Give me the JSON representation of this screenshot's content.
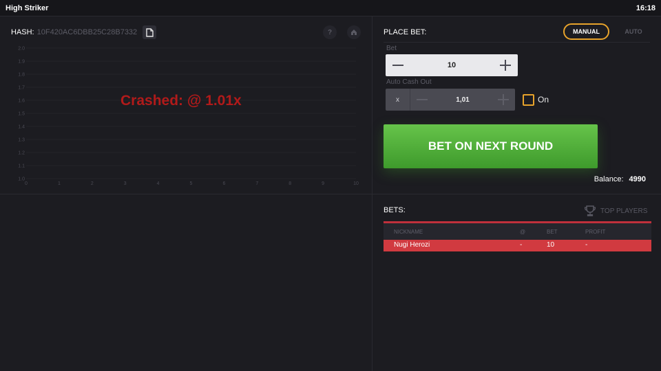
{
  "window": {
    "title": "High Striker",
    "time": "16:18"
  },
  "graph": {
    "hash_label": "HASH:",
    "hash_value": "10F420AC6DBB25C28B7332",
    "status": "Crashed: @ 1.01x"
  },
  "chart_data": {
    "type": "line",
    "x_ticks": [
      "0",
      "1",
      "2",
      "3",
      "4",
      "5",
      "6",
      "7",
      "8",
      "9",
      "10"
    ],
    "y_ticks": [
      "2.0",
      "1.9",
      "1.8",
      "1.7",
      "1.6",
      "1.5",
      "1.4",
      "1.3",
      "1.2",
      "1.1",
      "1.0"
    ],
    "xlim": [
      0,
      10
    ],
    "ylim": [
      1.0,
      2.0
    ],
    "series": []
  },
  "place_bet": {
    "title": "PLACE BET:",
    "modes": {
      "manual": "MANUAL",
      "auto": "AUTO",
      "selected": "MANUAL"
    },
    "bet_label": "Bet",
    "bet_value": "10",
    "auto_cashout_label": "Auto Cash Out",
    "auto_cashout_prefix": "x",
    "auto_cashout_value": "1,01",
    "auto_cashout_toggle_label": "On",
    "button_label": "BET ON NEXT ROUND",
    "balance_label": "Balance:",
    "balance_value": "4990"
  },
  "bets": {
    "title": "BETS:",
    "top_players_label": "TOP PLAYERS",
    "columns": [
      "NICKNAME",
      "@",
      "BET",
      "PROFIT"
    ],
    "rows": [
      {
        "nickname": "Nugi Herozi",
        "at": "-",
        "bet": "10",
        "profit": "-"
      }
    ]
  },
  "colors": {
    "background": "#1c1c21",
    "accent": "#e8a32b",
    "bet_button": "#4fae37",
    "crash_text": "#b11a1a",
    "bet_row": "#d13a40"
  }
}
